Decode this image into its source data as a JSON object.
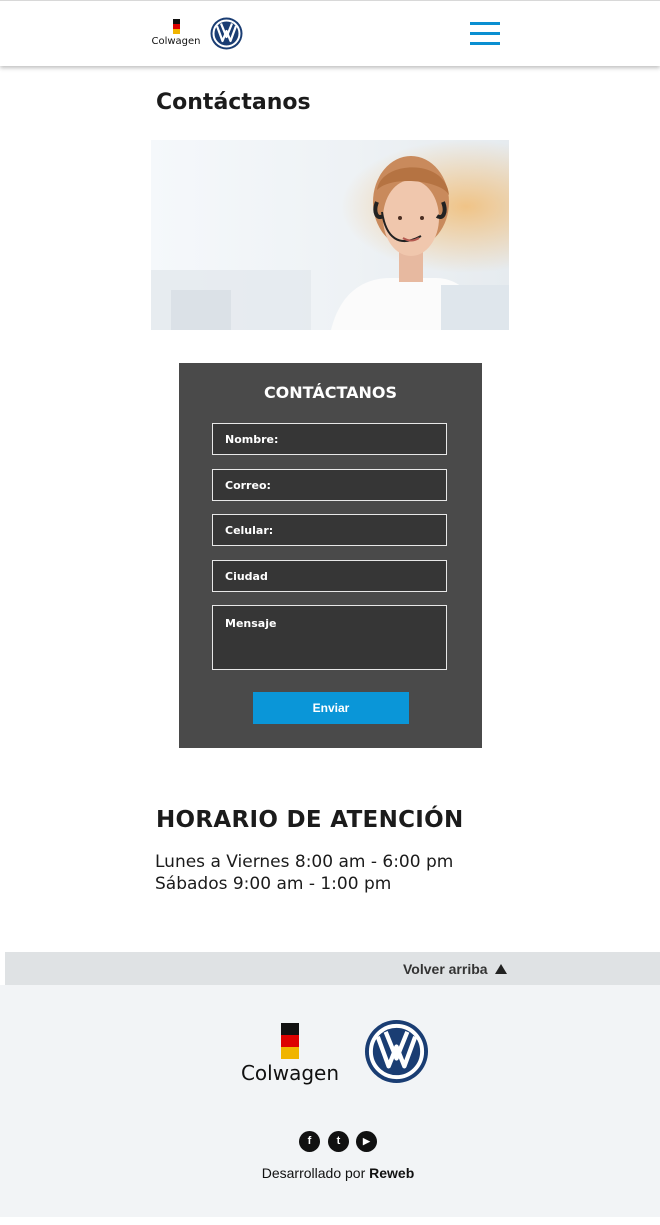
{
  "header": {
    "brand_dealer": "Colwagen",
    "menu_icon": "hamburger-icon",
    "vw_logo_icon": "vw-logo-icon"
  },
  "page": {
    "title": "Contáctanos"
  },
  "hero": {
    "image_icon": "customer-service-agent-image"
  },
  "form": {
    "title": "CONTÁCTANOS",
    "fields": [
      {
        "label": "Nombre:"
      },
      {
        "label": "Correo:"
      },
      {
        "label": "Celular:"
      },
      {
        "label": "Ciudad"
      },
      {
        "label": "Mensaje"
      }
    ],
    "submit_label": "Enviar"
  },
  "hours": {
    "title": "HORARIO DE ATENCIÓN",
    "lines": [
      "Lunes a Viernes 8:00 am - 6:00 pm",
      "Sábados 9:00 am - 1:00 pm"
    ]
  },
  "back_to_top": {
    "label": "Volver arriba",
    "icon": "triangle-up-icon"
  },
  "footer": {
    "brand_dealer": "Colwagen",
    "social": [
      {
        "name": "facebook-icon",
        "glyph": "f"
      },
      {
        "name": "twitter-icon",
        "glyph": "t"
      },
      {
        "name": "youtube-icon",
        "glyph": "▶"
      }
    ],
    "credit_prefix": "Desarrollado por ",
    "credit_brand": "Reweb"
  },
  "colors": {
    "accent": "#0a96d8",
    "form_bg": "#4a4a4a",
    "field_bg": "#363636",
    "footer_bg": "#f2f4f6",
    "back_bar": "#dfe2e4",
    "vw_blue": "#1a3d73"
  }
}
